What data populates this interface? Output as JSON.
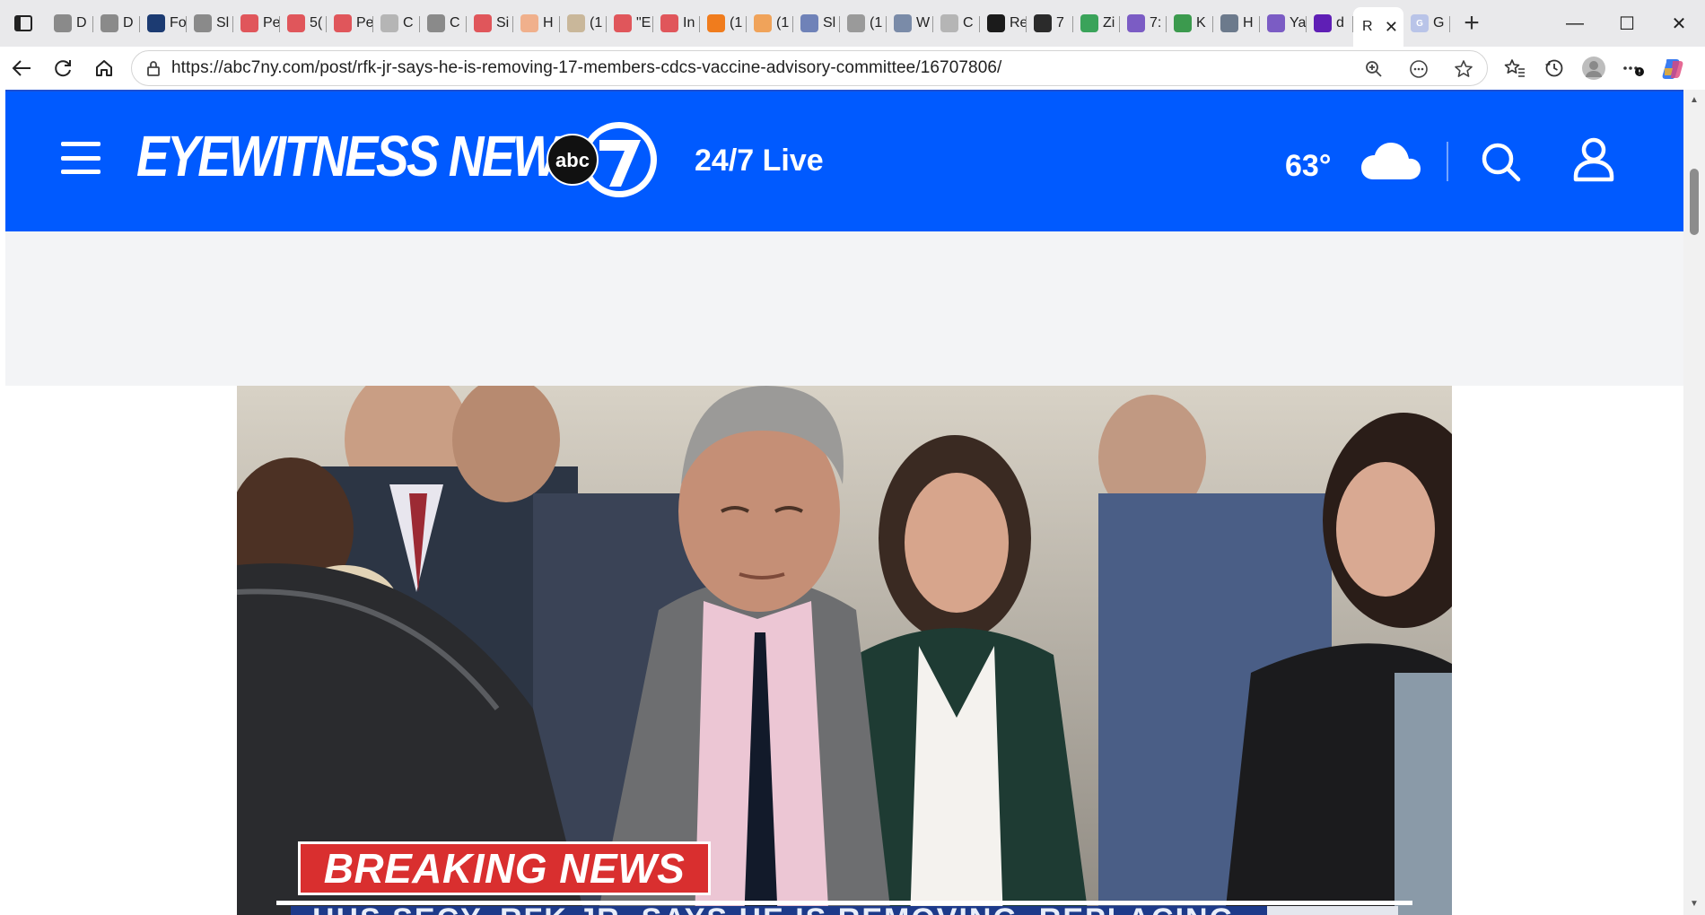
{
  "browser": {
    "tabs": [
      {
        "letter": "D",
        "color": "#8a8a8a"
      },
      {
        "letter": "D",
        "color": "#8a8a8a"
      },
      {
        "letter": "Fo",
        "color": "#1c3b72"
      },
      {
        "letter": "Sl",
        "color": "#8a8a8a"
      },
      {
        "letter": "Pe",
        "color": "#e0565b"
      },
      {
        "letter": "5(",
        "color": "#e0565b"
      },
      {
        "letter": "Pe",
        "color": "#e0565b"
      },
      {
        "letter": "C",
        "color": "#b5b5b5"
      },
      {
        "letter": "C",
        "color": "#8a8a8a"
      },
      {
        "letter": "Si",
        "color": "#e0565b"
      },
      {
        "letter": "H",
        "color": "#f0b08c"
      },
      {
        "letter": "(1",
        "color": "#c9b79a"
      },
      {
        "letter": "\"E",
        "color": "#e0565b"
      },
      {
        "letter": "In",
        "color": "#e0565b"
      },
      {
        "letter": "(1",
        "color": "#f07c1d"
      },
      {
        "letter": "(1",
        "color": "#f0a35a"
      },
      {
        "letter": "Sl",
        "color": "#6f82b8"
      },
      {
        "letter": "(1",
        "color": "#9a9a9a"
      },
      {
        "letter": "W",
        "color": "#7a8ba8"
      },
      {
        "letter": "C",
        "color": "#b5b5b5"
      },
      {
        "letter": "Re",
        "color": "#1b1b1b"
      },
      {
        "letter": "7",
        "color": "#2b2b2b"
      },
      {
        "letter": "Zi",
        "color": "#3aa35a"
      },
      {
        "letter": "7:",
        "color": "#7b5cc4"
      },
      {
        "letter": "K",
        "color": "#3c9a4e"
      },
      {
        "letter": "H",
        "color": "#6c7a8c"
      },
      {
        "letter": "Ya",
        "color": "#7b5cc4"
      },
      {
        "letter": "d",
        "color": "#5f1fb5"
      }
    ],
    "active_tab": {
      "letter": "R"
    },
    "last_tab": {
      "letter": "G",
      "color": "#b9c4e8"
    },
    "url": "https://abc7ny.com/post/rfk-jr-says-he-is-removing-17-members-cdcs-vaccine-advisory-committee/16707806/"
  },
  "site": {
    "logo_text": "EYEWITNESS NEWS",
    "logo_badge": "abc",
    "logo_number": "7",
    "live_label": "24/7 Live",
    "temperature": "63°",
    "weather_icon": "cloud-icon",
    "brand_color": "#005aff"
  },
  "hero": {
    "banner": "BREAKING NEWS",
    "ticker": "HHS SECY. RFK JR. SAYS HE IS REMOVING, REPLACING",
    "banner_color": "#d92f2f"
  }
}
